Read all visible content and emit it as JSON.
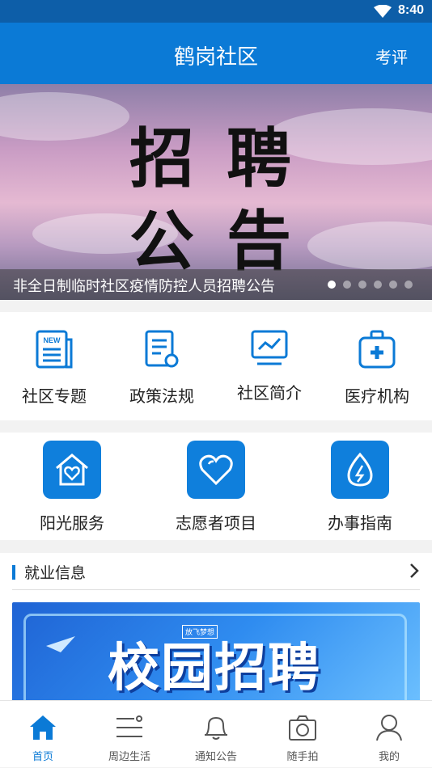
{
  "status": {
    "time": "8:40"
  },
  "header": {
    "title": "鹤岗社区",
    "action": "考评"
  },
  "banner": {
    "line1": "招聘",
    "line2": "公告",
    "caption": "非全日制临时社区疫情防控人员招聘公告",
    "slide_count": 6,
    "active_slide": 1
  },
  "grid1": [
    {
      "label": "社区专题",
      "icon": "newspaper-icon"
    },
    {
      "label": "政策法规",
      "icon": "document-icon"
    },
    {
      "label": "社区简介",
      "icon": "monitor-chart-icon"
    },
    {
      "label": "医疗机构",
      "icon": "medical-kit-icon"
    }
  ],
  "grid2": [
    {
      "label": "阳光服务",
      "icon": "house-heart-icon"
    },
    {
      "label": "志愿者项目",
      "icon": "heart-icon"
    },
    {
      "label": "办事指南",
      "icon": "drop-bolt-icon"
    }
  ],
  "section": {
    "title": "就业信息",
    "poster_text": "校园招聘",
    "poster_badge": "放飞梦想"
  },
  "tabs": [
    {
      "label": "首页",
      "icon": "home-icon",
      "active": true
    },
    {
      "label": "周边生活",
      "icon": "list-icon",
      "active": false
    },
    {
      "label": "通知公告",
      "icon": "bell-icon",
      "active": false
    },
    {
      "label": "随手拍",
      "icon": "camera-icon",
      "active": false
    },
    {
      "label": "我的",
      "icon": "user-icon",
      "active": false
    }
  ],
  "colors": {
    "primary": "#0b7ad6",
    "status_bar": "#0d5ea8"
  }
}
